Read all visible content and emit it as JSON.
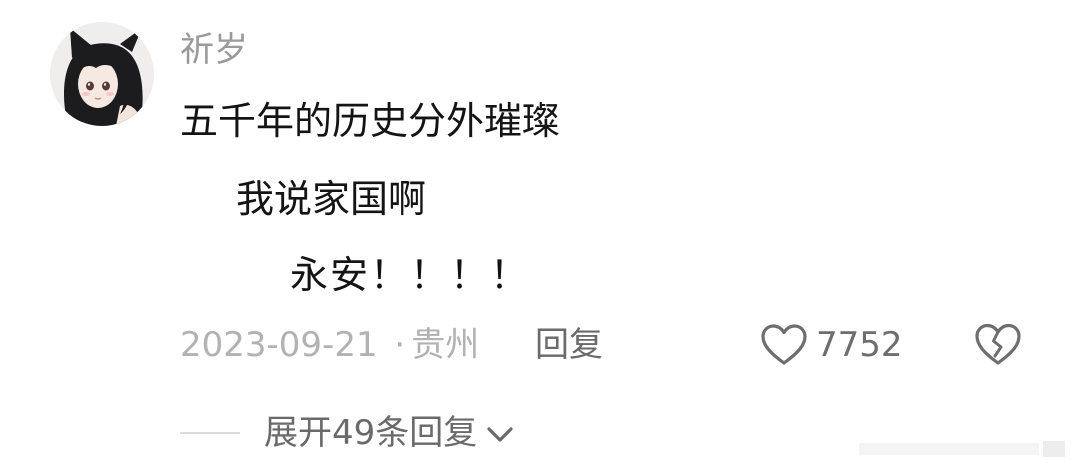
{
  "comment": {
    "username": "祈岁",
    "lines": [
      "五千年的历史分外璀璨",
      "我说家国啊",
      "永安！！！！"
    ],
    "date": "2023-09-21",
    "separator": "·",
    "location": "贵州",
    "reply_label": "回复",
    "like_count": "7752",
    "expand_label": "展开49条回复"
  },
  "icons": {
    "like": "heart-outline-icon",
    "dislike": "broken-heart-icon",
    "expand": "chevron-down-icon"
  },
  "colors": {
    "username": "#9a9a9a",
    "text": "#141414",
    "meta": "#b2b2b2",
    "action": "#6a6a6a"
  }
}
